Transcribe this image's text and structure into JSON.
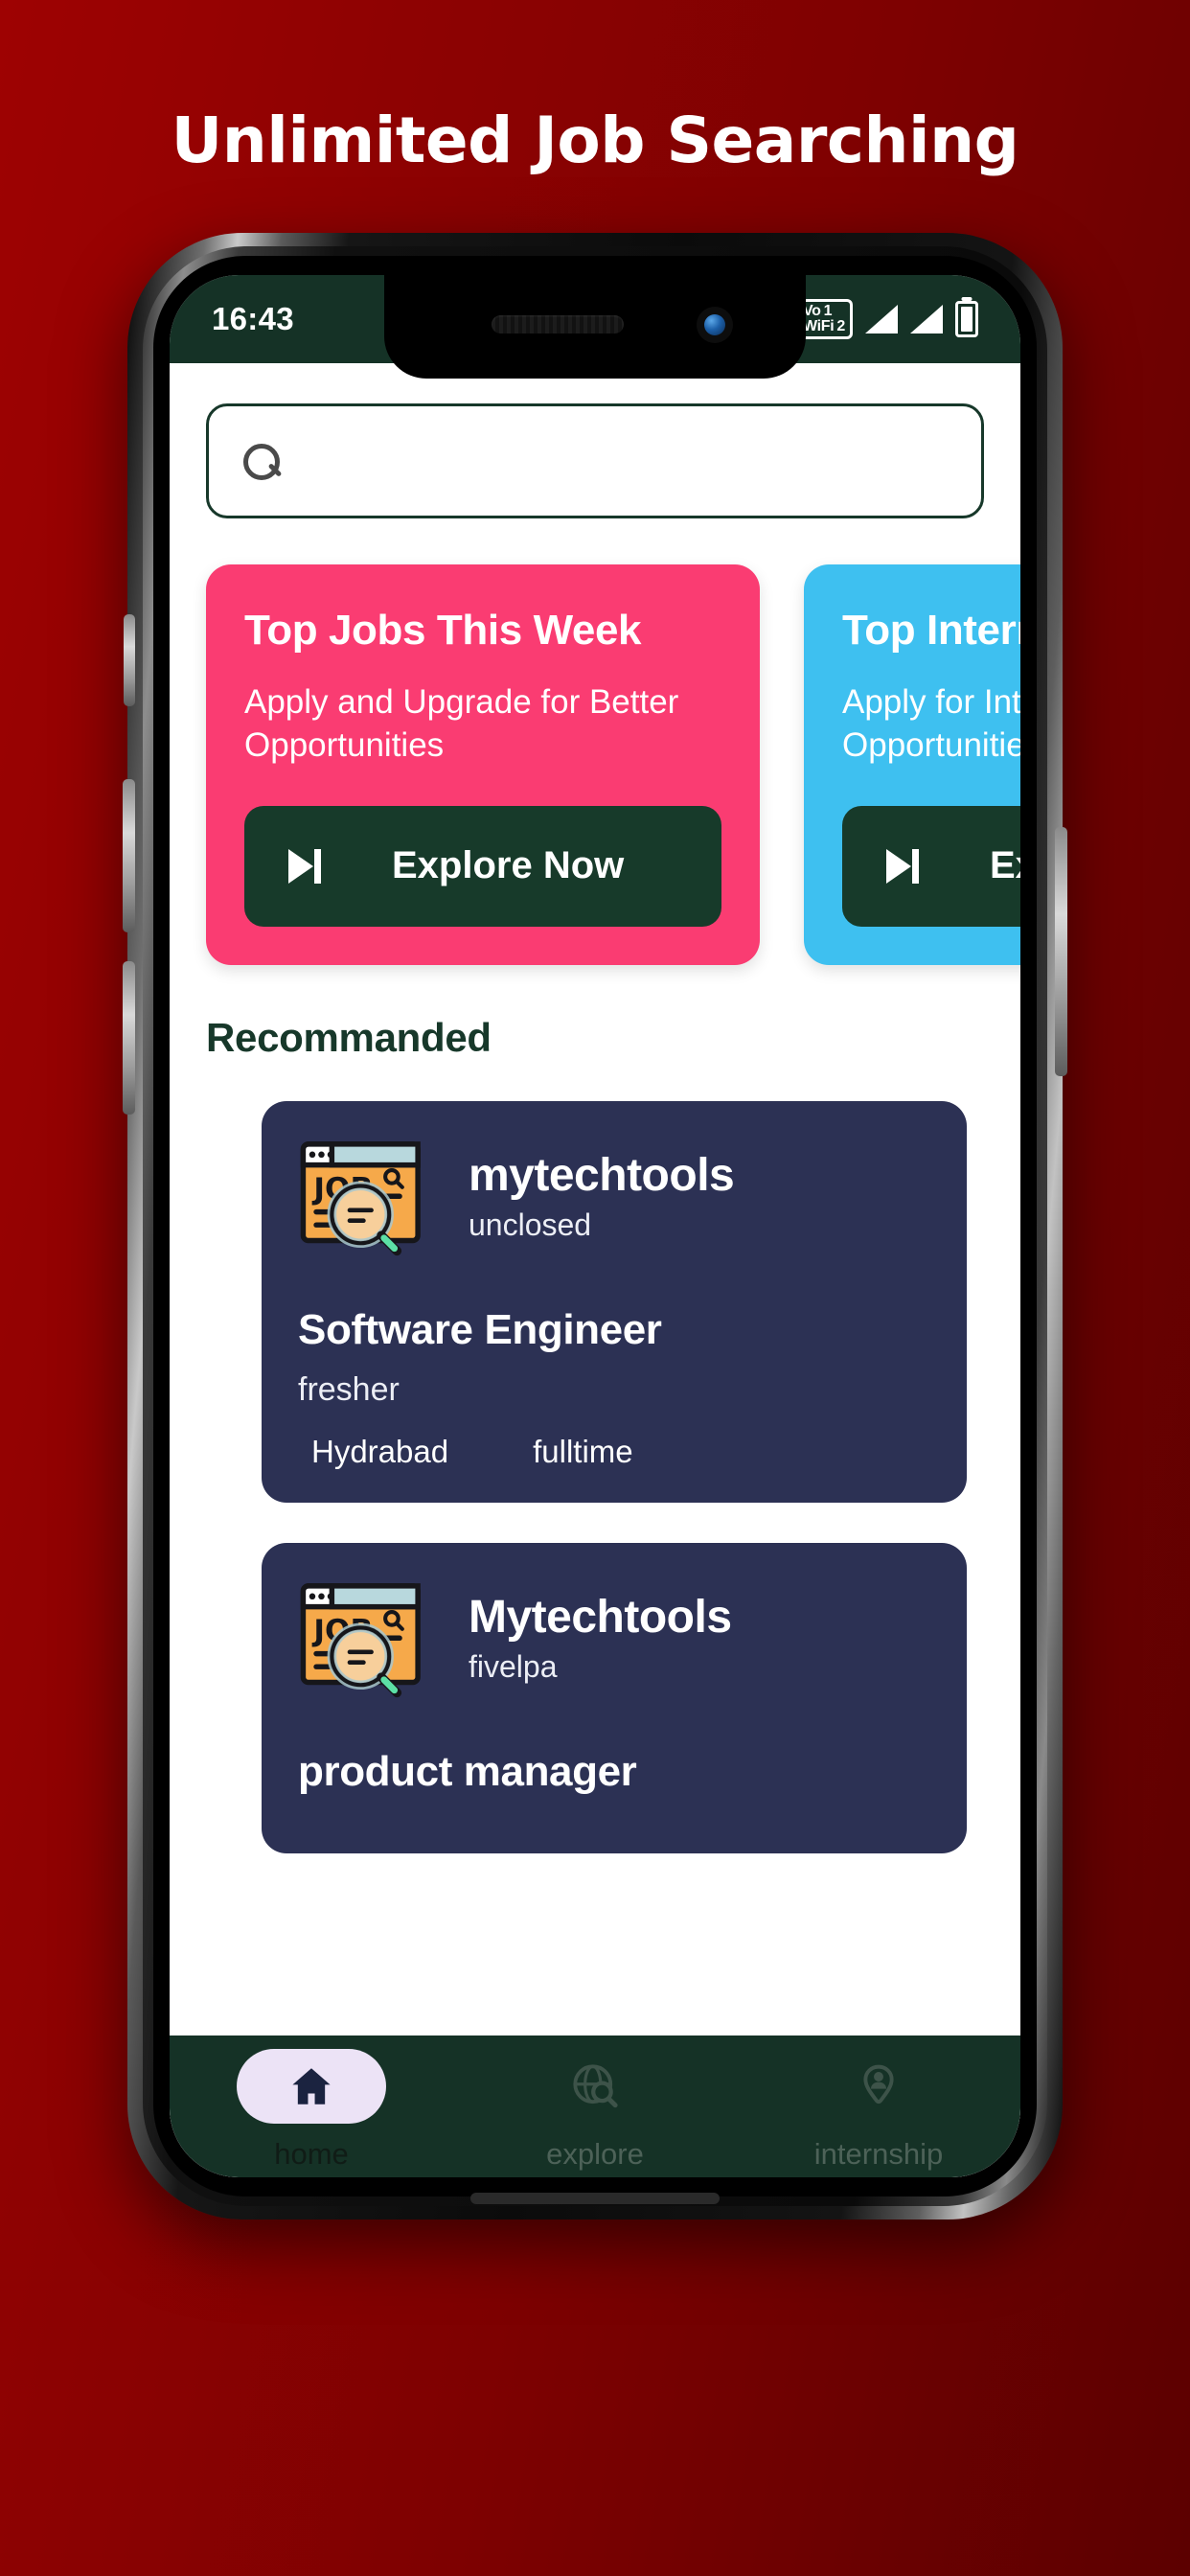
{
  "headline": "Unlimited Job Searching",
  "status_bar": {
    "time": "16:43",
    "vowifi_line1": "Vo",
    "vowifi_line2": "WiFi",
    "sim1": "1",
    "sim2": "2",
    "signal_icon": "signal-bars-icon",
    "battery_icon": "battery-icon"
  },
  "search": {
    "value": "",
    "placeholder": "",
    "icon": "search-icon"
  },
  "promos": [
    {
      "title": "Top Jobs This Week",
      "subtitle": "Apply and Upgrade for Better Opportunities",
      "button_label": "Explore Now",
      "button_icon": "skip-forward-icon",
      "color": "#fa3c72"
    },
    {
      "title": "Top Internships",
      "subtitle": "Apply for Internships and Better Opportunities",
      "button_label": "Explore Now",
      "button_icon": "skip-forward-icon",
      "color": "#3ec0f0"
    }
  ],
  "section": {
    "recommended_title": "Recommanded"
  },
  "jobs": [
    {
      "company": "mytechtools",
      "company_sub": "unclosed",
      "title": "Software Engineer",
      "level": "fresher",
      "location": "Hydrabad",
      "type": "fulltime",
      "icon": "job-search-icon"
    },
    {
      "company": "Mytechtools",
      "company_sub": "fivelpa",
      "title": "product manager",
      "level": "",
      "location": "",
      "type": "",
      "icon": "job-search-icon"
    }
  ],
  "bottom_nav": [
    {
      "label": "home",
      "icon": "home-icon",
      "active": true
    },
    {
      "label": "explore",
      "icon": "globe-search-icon",
      "active": false
    },
    {
      "label": "internship",
      "icon": "person-pin-icon",
      "active": false
    }
  ],
  "colors": {
    "background_red": "#8e0202",
    "brand_green": "#153226",
    "card_navy": "#2c3154",
    "pink": "#fa3c72",
    "blue": "#3ec0f0",
    "pill_lavender": "#ece3f6"
  }
}
